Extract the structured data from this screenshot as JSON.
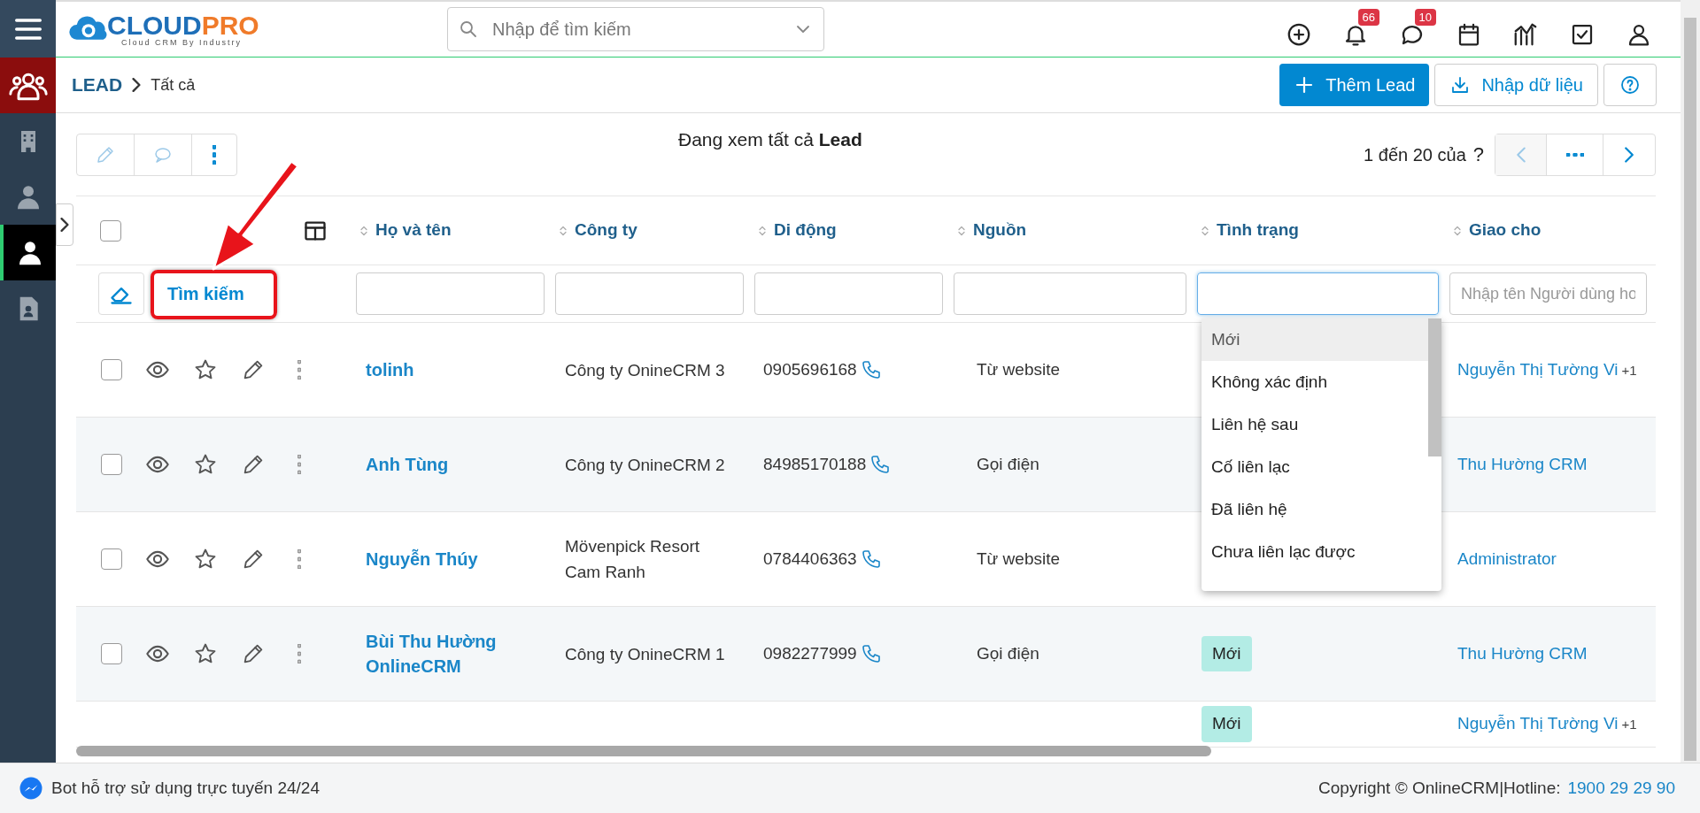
{
  "sidebar": {
    "items": [
      {
        "kind": "people",
        "highlighted": true,
        "selected": false
      },
      {
        "kind": "building",
        "highlighted": false,
        "selected": false
      },
      {
        "kind": "agent",
        "highlighted": false,
        "selected": false
      },
      {
        "kind": "person",
        "highlighted": false,
        "selected": true
      },
      {
        "kind": "document",
        "highlighted": false,
        "selected": false
      }
    ]
  },
  "logo": {
    "primary": "CLOUD",
    "accent": "PRO",
    "tagline": "Cloud CRM By Industry"
  },
  "topbar": {
    "search_placeholder": "Nhập để tìm kiếm",
    "icons": [
      {
        "kind": "add"
      },
      {
        "kind": "notifications",
        "badge": "66"
      },
      {
        "kind": "messages",
        "badge": "10"
      },
      {
        "kind": "calendar"
      },
      {
        "kind": "chart"
      },
      {
        "kind": "tasks"
      },
      {
        "kind": "user"
      }
    ]
  },
  "breadcrumb": {
    "module": "LEAD",
    "view": "Tất cả"
  },
  "actions": [
    {
      "kind": "primary",
      "label": "Thêm Lead"
    },
    {
      "kind": "import",
      "label": "Nhập dữ liệu"
    },
    {
      "kind": "help"
    }
  ],
  "list_title": "Đang xem tất cả **Lead**",
  "pagination": {
    "range": "1 đến 20 của",
    "total": "?"
  },
  "table": {
    "columns": [
      "Họ và tên",
      "Công ty",
      "Di động",
      "Nguồn",
      "Tình trạng",
      "Giao cho"
    ],
    "search_button": "Tìm kiếm",
    "select_all_checked": false,
    "filters": [
      {
        "focused": false
      },
      {
        "focused": false
      },
      {
        "focused": false
      },
      {
        "focused": false
      },
      {
        "focused": true
      },
      {
        "focused": false,
        "placeholder": "Nhập tên Người dùng ho"
      }
    ],
    "rows": [
      {
        "checked": false,
        "name": "tolinh",
        "company": "Công ty OnineCRM 3",
        "phone": "0905696168",
        "source": "Từ website",
        "assignee": "Nguyễn Thị Tường Vi",
        "assignee_extra": "+1"
      },
      {
        "checked": false,
        "name": "Anh Tùng",
        "company": "Công ty OnineCRM 2",
        "phone": "84985170188",
        "source": "Gọi điện",
        "assignee": "Thu Hường CRM"
      },
      {
        "checked": false,
        "name": "Nguyễn Thúy",
        "company": "Mövenpick Resort Cam Ranh",
        "phone": "0784406363",
        "source": "Từ website",
        "assignee": "Administrator"
      },
      {
        "checked": false,
        "name": "Bùi Thu Hường OnlineCRM",
        "company": "Công ty OnineCRM 1",
        "phone": "0982277999",
        "source": "Gọi điện",
        "status": "Mới",
        "assignee": "Thu Hường CRM"
      },
      {
        "status": "Mới",
        "assignee": "Nguyễn Thị Tường Vi",
        "assignee_extra": "+1"
      }
    ]
  },
  "status_dropdown": {
    "options": [
      {
        "label": "Mới",
        "highlighted": true
      },
      {
        "label": "Không xác định",
        "highlighted": false
      },
      {
        "label": "Liên hệ sau",
        "highlighted": false
      },
      {
        "label": "Cố liên lạc",
        "highlighted": false
      },
      {
        "label": "Đã liên hệ",
        "highlighted": false
      },
      {
        "label": "Chưa liên lạc được",
        "highlighted": false
      }
    ]
  },
  "footer": {
    "bot": "Bot hỗ trợ sử dụng trực tuyến 24/24",
    "copyright": "Copyright © OnlineCRM|Hotline:",
    "hotline": "1900 29 29 90"
  }
}
